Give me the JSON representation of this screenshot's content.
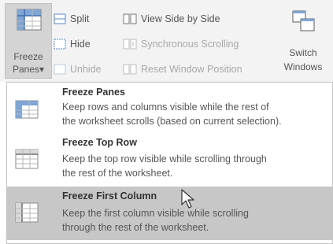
{
  "ribbon": {
    "freeze_panes": {
      "line1": "Freeze",
      "line2": "Panes",
      "caret": "▾",
      "icon": "freeze-panes-icon"
    },
    "split": {
      "label": "Split",
      "icon": "split-icon"
    },
    "hide": {
      "label": "Hide",
      "icon": "hide-icon"
    },
    "unhide": {
      "label": "Unhide",
      "icon": "unhide-icon",
      "disabled": true
    },
    "view_side_by_side": {
      "label": "View Side by Side",
      "icon": "view-side-by-side-icon"
    },
    "synchronous_scrolling": {
      "label": "Synchronous Scrolling",
      "icon": "synchronous-scrolling-icon",
      "disabled": true
    },
    "reset_window_position": {
      "label": "Reset Window Position",
      "icon": "reset-window-position-icon",
      "disabled": true
    },
    "switch_windows": {
      "line1": "Switch",
      "line2": "Windows",
      "icon": "switch-windows-icon"
    }
  },
  "menu": {
    "items": [
      {
        "title": "Freeze Panes",
        "desc1": "Keep rows and columns visible while the rest of",
        "desc2": "the worksheet scrolls (based on current selection).",
        "icon": "freeze-panes-icon"
      },
      {
        "title": "Freeze Top Row",
        "desc1": "Keep the top row visible while scrolling through",
        "desc2": "the rest of the worksheet.",
        "icon": "freeze-top-row-icon"
      },
      {
        "title": "Freeze First Column",
        "desc1": "Keep the first column visible while scrolling",
        "desc2": "through the rest of the worksheet.",
        "icon": "freeze-first-column-icon",
        "highlighted": true
      }
    ]
  },
  "colors": {
    "ribbon_bg": "#f3f3f3",
    "highlight": "#c7c7c7",
    "accent": "#5b8bc7"
  }
}
